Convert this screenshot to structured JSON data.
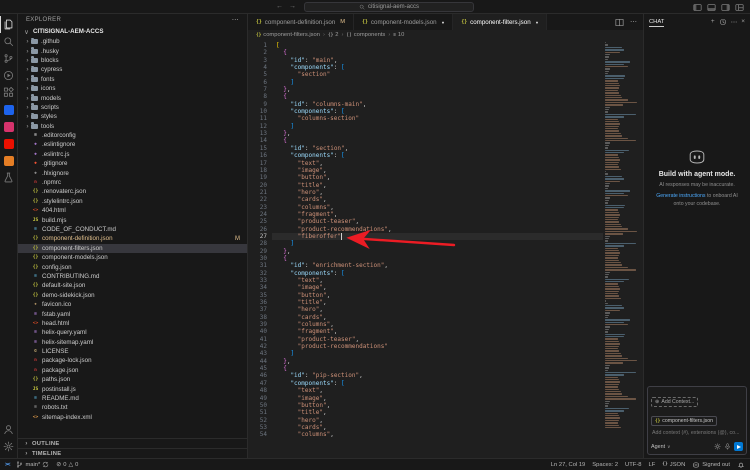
{
  "title_bar": {
    "search_value": "citisignal-aem-accs"
  },
  "activity_bar": {
    "top": [
      {
        "name": "explorer-icon",
        "icon": "files",
        "active": true
      },
      {
        "name": "search-icon",
        "icon": "search"
      },
      {
        "name": "source-control-icon",
        "icon": "scm"
      },
      {
        "name": "run-and-debug-icon",
        "icon": "debug"
      },
      {
        "name": "extensions-icon",
        "icon": "ext"
      },
      {
        "name": "docker-extension-icon",
        "color": "#1d63ed"
      },
      {
        "name": "gitlens-extension-icon",
        "color": "#d6336c"
      },
      {
        "name": "adobe-aem-extension-icon",
        "color": "#eb1000"
      },
      {
        "name": "aws-toolkit-extension-icon",
        "color": "#e57e25"
      },
      {
        "name": "testing-icon",
        "icon": "beaker"
      }
    ],
    "bottom": [
      {
        "name": "account-icon",
        "icon": "account"
      },
      {
        "name": "settings-gear-icon",
        "icon": "gear"
      }
    ]
  },
  "explorer": {
    "title": "EXPLORER",
    "root_label": "CITISIGNAL-AEM-ACCS",
    "items": [
      {
        "type": "folder",
        "label": ".github"
      },
      {
        "type": "folder",
        "label": ".husky"
      },
      {
        "type": "folder",
        "label": "blocks"
      },
      {
        "type": "folder",
        "label": "cypress"
      },
      {
        "type": "folder",
        "label": "fonts"
      },
      {
        "type": "folder",
        "label": "icons"
      },
      {
        "type": "folder",
        "label": "models"
      },
      {
        "type": "folder",
        "label": "scripts"
      },
      {
        "type": "folder",
        "label": "styles"
      },
      {
        "type": "folder",
        "label": "tools"
      },
      {
        "type": "file",
        "label": ".editorconfig",
        "icon": "≡",
        "icon_color": "#c5c5c5"
      },
      {
        "type": "file",
        "label": ".eslintignore",
        "icon": "◆",
        "icon_color": "#a074c4"
      },
      {
        "type": "file",
        "label": ".eslintrc.js",
        "icon": "◆",
        "icon_color": "#a074c4"
      },
      {
        "type": "file",
        "label": ".gitignore",
        "icon": "◆",
        "icon_color": "#f05133"
      },
      {
        "type": "file",
        "label": ".hlxignore",
        "icon": "◆",
        "icon_color": "#8a8a8a"
      },
      {
        "type": "file",
        "label": ".npmrc",
        "icon": "n",
        "icon_color": "#cb3837"
      },
      {
        "type": "file",
        "label": ".renovaterc.json",
        "icon": "{}",
        "icon_color": "#cbcb41"
      },
      {
        "type": "file",
        "label": ".stylelintrc.json",
        "icon": "{}",
        "icon_color": "#cbcb41"
      },
      {
        "type": "file",
        "label": "404.html",
        "icon": "<>",
        "icon_color": "#e44d26"
      },
      {
        "type": "file",
        "label": "build.mjs",
        "icon": "JS",
        "icon_color": "#cbcb41"
      },
      {
        "type": "file",
        "label": "CODE_OF_CONDUCT.md",
        "icon": "≡",
        "icon_color": "#519aba"
      },
      {
        "type": "file",
        "label": "component-definition.json",
        "icon": "{}",
        "icon_color": "#cbcb41",
        "modified": true,
        "badge": "M"
      },
      {
        "type": "file",
        "label": "component-filters.json",
        "icon": "{}",
        "icon_color": "#cbcb41",
        "selected": true
      },
      {
        "type": "file",
        "label": "component-models.json",
        "icon": "{}",
        "icon_color": "#cbcb41"
      },
      {
        "type": "file",
        "label": "config.json",
        "icon": "{}",
        "icon_color": "#cbcb41"
      },
      {
        "type": "file",
        "label": "CONTRIBUTING.md",
        "icon": "≡",
        "icon_color": "#519aba"
      },
      {
        "type": "file",
        "label": "default-site.json",
        "icon": "{}",
        "icon_color": "#cbcb41"
      },
      {
        "type": "file",
        "label": "demo-sidekick.json",
        "icon": "{}",
        "icon_color": "#cbcb41"
      },
      {
        "type": "file",
        "label": "favicon.ico",
        "icon": "★",
        "icon_color": "#dcb67a"
      },
      {
        "type": "file",
        "label": "fstab.yaml",
        "icon": "≡",
        "icon_color": "#a074c4"
      },
      {
        "type": "file",
        "label": "head.html",
        "icon": "<>",
        "icon_color": "#e44d26"
      },
      {
        "type": "file",
        "label": "helix-query.yaml",
        "icon": "≡",
        "icon_color": "#a074c4"
      },
      {
        "type": "file",
        "label": "helix-sitemap.yaml",
        "icon": "≡",
        "icon_color": "#a074c4"
      },
      {
        "type": "file",
        "label": "LICENSE",
        "icon": "©",
        "icon_color": "#d7ba7d"
      },
      {
        "type": "file",
        "label": "package-lock.json",
        "icon": "n",
        "icon_color": "#cb3837"
      },
      {
        "type": "file",
        "label": "package.json",
        "icon": "n",
        "icon_color": "#cb3837"
      },
      {
        "type": "file",
        "label": "paths.json",
        "icon": "{}",
        "icon_color": "#cbcb41"
      },
      {
        "type": "file",
        "label": "postinstall.js",
        "icon": "JS",
        "icon_color": "#cbcb41"
      },
      {
        "type": "file",
        "label": "README.md",
        "icon": "≡",
        "icon_color": "#519aba"
      },
      {
        "type": "file",
        "label": "robots.txt",
        "icon": "≡",
        "icon_color": "#8a8a8a"
      },
      {
        "type": "file",
        "label": "sitemap-index.xml",
        "icon": "<>",
        "icon_color": "#e8a04c"
      }
    ],
    "sections": [
      {
        "label": "OUTLINE"
      },
      {
        "label": "TIMELINE"
      }
    ]
  },
  "tabs": [
    {
      "label": "component-definition.json",
      "icon": "{}",
      "icon_color": "#cbcb41",
      "badge": "M"
    },
    {
      "label": "component-models.json",
      "icon": "{}",
      "icon_color": "#cbcb41",
      "badge": "dot"
    },
    {
      "label": "component-filters.json",
      "icon": "{}",
      "icon_color": "#cbcb41",
      "badge": "dot",
      "active": true
    }
  ],
  "breadcrumbs": [
    {
      "label": "component-filters.json",
      "icon": "{}",
      "icon_color": "#cbcb41",
      "icon_name": "json-file-icon"
    },
    {
      "label": "2",
      "icon": "{}",
      "icon_color": "#9d9d9d",
      "icon_name": "symbol-object-icon"
    },
    {
      "label": "components",
      "icon": "[]",
      "icon_color": "#9d9d9d",
      "icon_name": "symbol-array-icon"
    },
    {
      "label": "10",
      "icon": "≡",
      "icon_color": "#9d9d9d",
      "icon_name": "symbol-string-icon"
    }
  ],
  "editor": {
    "active_line": 27,
    "lines": [
      [
        [
          "[",
          "b0"
        ]
      ],
      [
        [
          "  {",
          "b1"
        ]
      ],
      [
        [
          "    \"id\"",
          "k"
        ],
        [
          ": ",
          "p"
        ],
        [
          "\"main\"",
          "s"
        ],
        [
          ",",
          "p"
        ]
      ],
      [
        [
          "    \"components\"",
          "k"
        ],
        [
          ": ",
          "p"
        ],
        [
          "[",
          "b2"
        ]
      ],
      [
        [
          "      \"section\"",
          "s"
        ]
      ],
      [
        [
          "    ]",
          "b2"
        ]
      ],
      [
        [
          "  }",
          "b1"
        ],
        [
          ",",
          "p"
        ]
      ],
      [
        [
          "  {",
          "b1"
        ]
      ],
      [
        [
          "    \"id\"",
          "k"
        ],
        [
          ": ",
          "p"
        ],
        [
          "\"columns-main\"",
          "s"
        ],
        [
          ",",
          "p"
        ]
      ],
      [
        [
          "    \"components\"",
          "k"
        ],
        [
          ": ",
          "p"
        ],
        [
          "[",
          "b2"
        ]
      ],
      [
        [
          "      \"columns-section\"",
          "s"
        ]
      ],
      [
        [
          "    ]",
          "b2"
        ]
      ],
      [
        [
          "  }",
          "b1"
        ],
        [
          ",",
          "p"
        ]
      ],
      [
        [
          "  {",
          "b1"
        ]
      ],
      [
        [
          "    \"id\"",
          "k"
        ],
        [
          ": ",
          "p"
        ],
        [
          "\"section\"",
          "s"
        ],
        [
          ",",
          "p"
        ]
      ],
      [
        [
          "    \"components\"",
          "k"
        ],
        [
          ": ",
          "p"
        ],
        [
          "[",
          "b2"
        ]
      ],
      [
        [
          "      \"text\"",
          "s"
        ],
        [
          ",",
          "p"
        ]
      ],
      [
        [
          "      \"image\"",
          "s"
        ],
        [
          ",",
          "p"
        ]
      ],
      [
        [
          "      \"button\"",
          "s"
        ],
        [
          ",",
          "p"
        ]
      ],
      [
        [
          "      \"title\"",
          "s"
        ],
        [
          ",",
          "p"
        ]
      ],
      [
        [
          "      \"hero\"",
          "s"
        ],
        [
          ",",
          "p"
        ]
      ],
      [
        [
          "      \"cards\"",
          "s"
        ],
        [
          ",",
          "p"
        ]
      ],
      [
        [
          "      \"columns\"",
          "s"
        ],
        [
          ",",
          "p"
        ]
      ],
      [
        [
          "      \"fragment\"",
          "s"
        ],
        [
          ",",
          "p"
        ]
      ],
      [
        [
          "      \"product-teaser\"",
          "s"
        ],
        [
          ",",
          "p"
        ]
      ],
      [
        [
          "      \"product-recommendations\"",
          "s"
        ],
        [
          ",",
          "p"
        ]
      ],
      [
        [
          "      \"fiberoffer\"",
          "s"
        ]
      ],
      [
        [
          "    ]",
          "b2"
        ]
      ],
      [
        [
          "  }",
          "b1"
        ],
        [
          ",",
          "p"
        ]
      ],
      [
        [
          "  {",
          "b1"
        ]
      ],
      [
        [
          "    \"id\"",
          "k"
        ],
        [
          ": ",
          "p"
        ],
        [
          "\"enrichment-section\"",
          "s"
        ],
        [
          ",",
          "p"
        ]
      ],
      [
        [
          "    \"components\"",
          "k"
        ],
        [
          ": ",
          "p"
        ],
        [
          "[",
          "b2"
        ]
      ],
      [
        [
          "      \"text\"",
          "s"
        ],
        [
          ",",
          "p"
        ]
      ],
      [
        [
          "      \"image\"",
          "s"
        ],
        [
          ",",
          "p"
        ]
      ],
      [
        [
          "      \"button\"",
          "s"
        ],
        [
          ",",
          "p"
        ]
      ],
      [
        [
          "      \"title\"",
          "s"
        ],
        [
          ",",
          "p"
        ]
      ],
      [
        [
          "      \"hero\"",
          "s"
        ],
        [
          ",",
          "p"
        ]
      ],
      [
        [
          "      \"cards\"",
          "s"
        ],
        [
          ",",
          "p"
        ]
      ],
      [
        [
          "      \"columns\"",
          "s"
        ],
        [
          ",",
          "p"
        ]
      ],
      [
        [
          "      \"fragment\"",
          "s"
        ],
        [
          ",",
          "p"
        ]
      ],
      [
        [
          "      \"product-teaser\"",
          "s"
        ],
        [
          ",",
          "p"
        ]
      ],
      [
        [
          "      \"product-recommendations\"",
          "s"
        ]
      ],
      [
        [
          "    ]",
          "b2"
        ]
      ],
      [
        [
          "  }",
          "b1"
        ],
        [
          ",",
          "p"
        ]
      ],
      [
        [
          "  {",
          "b1"
        ]
      ],
      [
        [
          "    \"id\"",
          "k"
        ],
        [
          ": ",
          "p"
        ],
        [
          "\"pip-section\"",
          "s"
        ],
        [
          ",",
          "p"
        ]
      ],
      [
        [
          "    \"components\"",
          "k"
        ],
        [
          ": ",
          "p"
        ],
        [
          "[",
          "b2"
        ]
      ],
      [
        [
          "      \"text\"",
          "s"
        ],
        [
          ",",
          "p"
        ]
      ],
      [
        [
          "      \"image\"",
          "s"
        ],
        [
          ",",
          "p"
        ]
      ],
      [
        [
          "      \"button\"",
          "s"
        ],
        [
          ",",
          "p"
        ]
      ],
      [
        [
          "      \"title\"",
          "s"
        ],
        [
          ",",
          "p"
        ]
      ],
      [
        [
          "      \"hero\"",
          "s"
        ],
        [
          ",",
          "p"
        ]
      ],
      [
        [
          "      \"cards\"",
          "s"
        ],
        [
          ",",
          "p"
        ]
      ],
      [
        [
          "      \"columns\"",
          "s"
        ],
        [
          ",",
          "p"
        ]
      ]
    ]
  },
  "chat": {
    "tab_label": "CHAT",
    "header_icons": [
      {
        "name": "new-chat-icon",
        "glyph": "+"
      },
      {
        "name": "history-icon",
        "icon": "history"
      },
      {
        "name": "more-icon",
        "glyph": "⋯"
      },
      {
        "name": "close-icon",
        "glyph": "×"
      }
    ],
    "welcome": {
      "title": "Build with agent mode.",
      "subtitle": "AI responses may be inaccurate.",
      "link_text": "Generate instructions",
      "link_suffix": " to onboard AI onto your codebase."
    },
    "input": {
      "add_context": "Add Context...",
      "chip_icon": "{}",
      "chip_label": "component-filters.json",
      "placeholder": "Add context (#), extensions (@), co...",
      "mode": "Agent"
    }
  },
  "status_bar": {
    "left": {
      "remote_label": "><",
      "branch": "main*",
      "errors": "0",
      "warnings": "0"
    },
    "right": [
      {
        "name": "cursor-position",
        "label": "Ln 27, Col 19"
      },
      {
        "name": "indentation",
        "label": "Spaces: 2"
      },
      {
        "name": "encoding",
        "label": "UTF-8"
      },
      {
        "name": "eol",
        "label": "LF"
      },
      {
        "name": "language-mode",
        "icon_glyph": "{}",
        "label": "JSON"
      },
      {
        "name": "copilot-status",
        "icon": "copilot",
        "label": "Signed out"
      },
      {
        "name": "notifications-bell",
        "icon": "bell"
      }
    ]
  },
  "annotation": {
    "arrow_color": "#ec1c24"
  }
}
